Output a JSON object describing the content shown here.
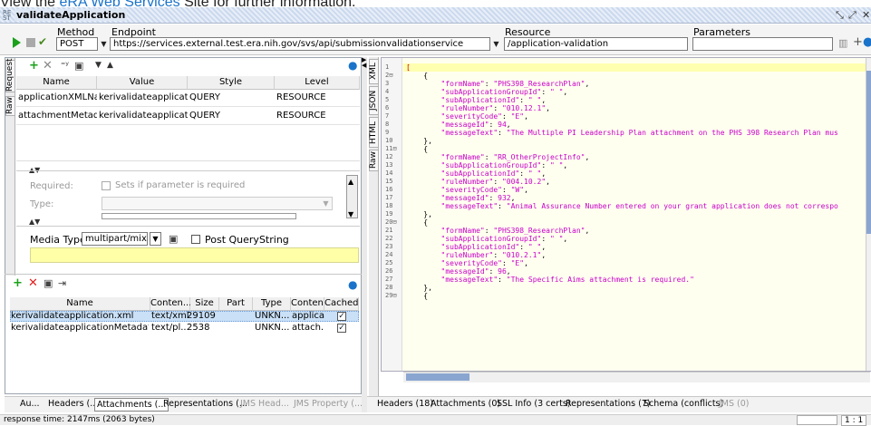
{
  "banner": {
    "prefix": "View the ",
    "link": "eRA Web Services",
    "suffix": " Site for further information."
  },
  "window": {
    "title": "validateApplication"
  },
  "toolbar": {
    "method_label": "Method",
    "method_value": "POST",
    "endpoint_label": "Endpoint",
    "endpoint_value": "https://services.external.test.era.nih.gov/svs/api/submissionvalidationservice",
    "resource_label": "Resource",
    "resource_value": "/application-validation",
    "parameters_label": "Parameters",
    "parameters_value": ""
  },
  "request": {
    "vtabs": [
      "Request",
      "Raw"
    ],
    "columns": [
      "Name",
      "Value",
      "Style",
      "Level"
    ],
    "rows": [
      {
        "name": "applicationXMLName",
        "value": "kerivalidateapplicati...",
        "style": "QUERY",
        "level": "RESOURCE"
      },
      {
        "name": "attachmentMetadata",
        "value": "kerivalidateapplicati...",
        "style": "QUERY",
        "level": "RESOURCE"
      }
    ],
    "required_label": "Required:",
    "required_hint": "Sets if parameter is required",
    "type_label": "Type:",
    "media_type_label": "Media Type",
    "media_type_value": "multipart/mixed",
    "post_querystring_label": "Post QueryString"
  },
  "attachments": {
    "columns": [
      "Name",
      "Conten...",
      "Size",
      "Part",
      "Type",
      "Conten...",
      "Cached"
    ],
    "rows": [
      {
        "name": "kerivalidateapplication.xml",
        "content": "text/xml",
        "size": "29109",
        "part": "",
        "type": "UNKN...",
        "content2": "applica...",
        "cached": true
      },
      {
        "name": "kerivalidateapplicationMetadata.txt",
        "content": "text/pl...",
        "size": "2538",
        "part": "",
        "type": "UNKN...",
        "content2": "attach...",
        "cached": true
      }
    ]
  },
  "request_bottom_tabs": [
    "Au...",
    "Headers (...",
    "Attachments (...",
    "Representations (...",
    "JMS Head...",
    "JMS Property (..."
  ],
  "status": {
    "response_time": "response time: 2147ms (2063 bytes)",
    "position": "1 : 1"
  },
  "response": {
    "vtabs": [
      "XML",
      "JSON",
      "HTML",
      "Raw"
    ],
    "line_numbers": [
      "1",
      "2⊟",
      "3",
      "4",
      "5",
      "6",
      "7",
      "8",
      "9",
      "10",
      "11⊟",
      "12",
      "13",
      "14",
      "15",
      "16",
      "17",
      "18",
      "19",
      "20⊟",
      "21",
      "22",
      "23",
      "24",
      "25",
      "26",
      "27",
      "28",
      "29⊟"
    ],
    "lines": [
      "[",
      "    {",
      "        \"formName\": \"PHS398_ResearchPlan\",",
      "        \"subApplicationGroupId\": \" \",",
      "        \"subApplicationId\": \" \",",
      "        \"ruleNumber\": \"010.12.1\",",
      "        \"severityCode\": \"E\",",
      "        \"messageId\": 94,",
      "        \"messageText\": \"The Multiple PI Leadership Plan attachment on the PHS 398 Research Plan mus",
      "    },",
      "    {",
      "        \"formName\": \"RR_OtherProjectInfo\",",
      "        \"subApplicationGroupId\": \" \",",
      "        \"subApplicationId\": \" \",",
      "        \"ruleNumber\": \"004.10.2\",",
      "        \"severityCode\": \"W\",",
      "        \"messageId\": 932,",
      "        \"messageText\": \"Animal Assurance Number entered on your grant application does not correspo",
      "    },",
      "    {",
      "        \"formName\": \"PHS398_ResearchPlan\",",
      "        \"subApplicationGroupId\": \" \",",
      "        \"subApplicationId\": \" \",",
      "        \"ruleNumber\": \"010.2.1\",",
      "        \"severityCode\": \"E\",",
      "        \"messageId\": 96,",
      "        \"messageText\": \"The Specific Aims attachment is required.\"",
      "    },",
      "    {"
    ],
    "bottom_tabs": [
      "Headers (18)",
      "Attachments (0)",
      "SSL Info (3 certs)",
      "Representations (7)",
      "Schema (conflicts)",
      "JMS (0)"
    ]
  },
  "colors": {
    "string": "#c800c8",
    "number": "#c800c8",
    "key": "#c800c8",
    "punct": "#000000",
    "selection": "#c9e0f7",
    "highlight": "#ffffd0"
  }
}
